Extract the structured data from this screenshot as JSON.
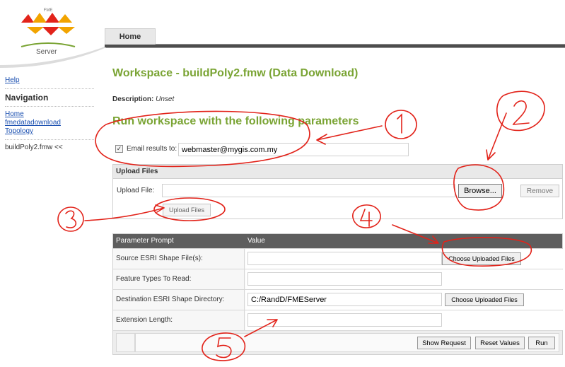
{
  "logo": {
    "product": "Server",
    "icon": "fme-logo-icon"
  },
  "tabs": {
    "home": "Home"
  },
  "sidebar": {
    "help": "Help",
    "nav_heading": "Navigation",
    "links": [
      "Home",
      "fmedatadownload",
      "Topology"
    ],
    "current": "buildPoly2.fmw <<"
  },
  "main": {
    "title": "Workspace - buildPoly2.fmw (Data Download)",
    "description_label": "Description:",
    "description_value": "Unset",
    "run_heading": "Run workspace with the following parameters"
  },
  "email": {
    "checked": true,
    "label": "Email results to:",
    "value": "webmaster@mygis.com.my"
  },
  "upload": {
    "header": "Upload Files",
    "label": "Upload File:",
    "browse": "Browse...",
    "remove": "Remove",
    "upload_button": "Upload Files"
  },
  "params": {
    "col_prompt": "Parameter Prompt",
    "col_value": "Value",
    "rows": [
      {
        "prompt": "Source ESRI Shape File(s):",
        "value": "",
        "button": "Choose Uploaded Files"
      },
      {
        "prompt": "Feature Types To Read:",
        "value": ""
      },
      {
        "prompt": "Destination ESRI Shape Directory:",
        "value": "C:/RandD/FMEServer",
        "button": "Choose Uploaded Files"
      },
      {
        "prompt": "Extension Length:",
        "value": ""
      }
    ]
  },
  "actions": {
    "show_request": "Show Request",
    "reset_values": "Reset Values",
    "run": "Run"
  },
  "colors": {
    "accent_green": "#7aa434",
    "annotation_red": "#e2231a",
    "header_dark": "#5e5e5e"
  }
}
